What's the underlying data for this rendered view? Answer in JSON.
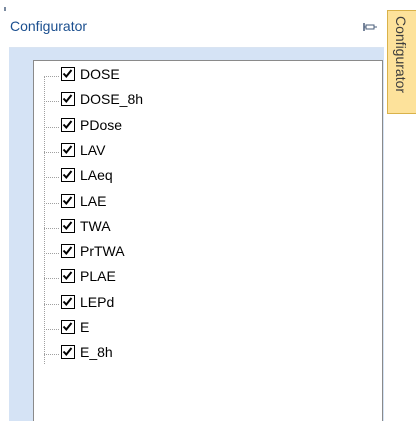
{
  "panel": {
    "title": "Configurator",
    "pin_icon": "pin-icon"
  },
  "side_tab": {
    "label": "Configurator"
  },
  "tree": {
    "items": [
      {
        "label": "DOSE",
        "checked": true
      },
      {
        "label": "DOSE_8h",
        "checked": true
      },
      {
        "label": "PDose",
        "checked": true
      },
      {
        "label": "LAV",
        "checked": true
      },
      {
        "label": "LAeq",
        "checked": true
      },
      {
        "label": "LAE",
        "checked": true
      },
      {
        "label": "TWA",
        "checked": true
      },
      {
        "label": "PrTWA",
        "checked": true
      },
      {
        "label": "PLAE",
        "checked": true
      },
      {
        "label": "LEPd",
        "checked": true
      },
      {
        "label": "E",
        "checked": true
      },
      {
        "label": "E_8h",
        "checked": true
      }
    ]
  },
  "colors": {
    "panel_background": "#d5e3f5",
    "title_text": "#1b4f8f",
    "tab_background": "#fde29b"
  }
}
